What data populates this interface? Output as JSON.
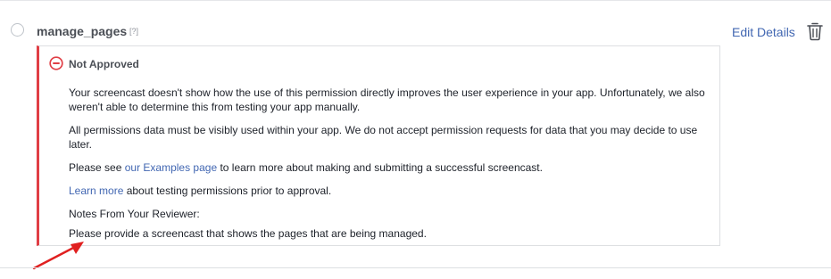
{
  "permission": {
    "name": "manage_pages",
    "help_label": "[?]",
    "edit_label": "Edit Details"
  },
  "review": {
    "status": "Not Approved",
    "paragraph_1": "Your screencast doesn't show how the use of this permission directly improves the user experience in your app. Unfortunately, we also weren't able to determine this from testing your app manually.",
    "paragraph_2": "All permissions data must be visibly used within your app. We do not accept permission requests for data that you may decide to use later.",
    "paragraph_3_before": "Please see ",
    "paragraph_3_link": "our Examples page",
    "paragraph_3_after": " to learn more about making and submitting a successful screencast.",
    "paragraph_4_link": "Learn more",
    "paragraph_4_after": " about testing permissions prior to approval.",
    "notes_heading": "Notes From Your Reviewer:",
    "notes_text": "Please provide a screencast that shows the pages that are being managed."
  },
  "colors": {
    "accent_link": "#4267b2",
    "rejected_red": "#e03e45",
    "annotation_arrow": "#e02020"
  },
  "icons": {
    "status": "minus-circle-icon",
    "delete": "trash-icon"
  }
}
